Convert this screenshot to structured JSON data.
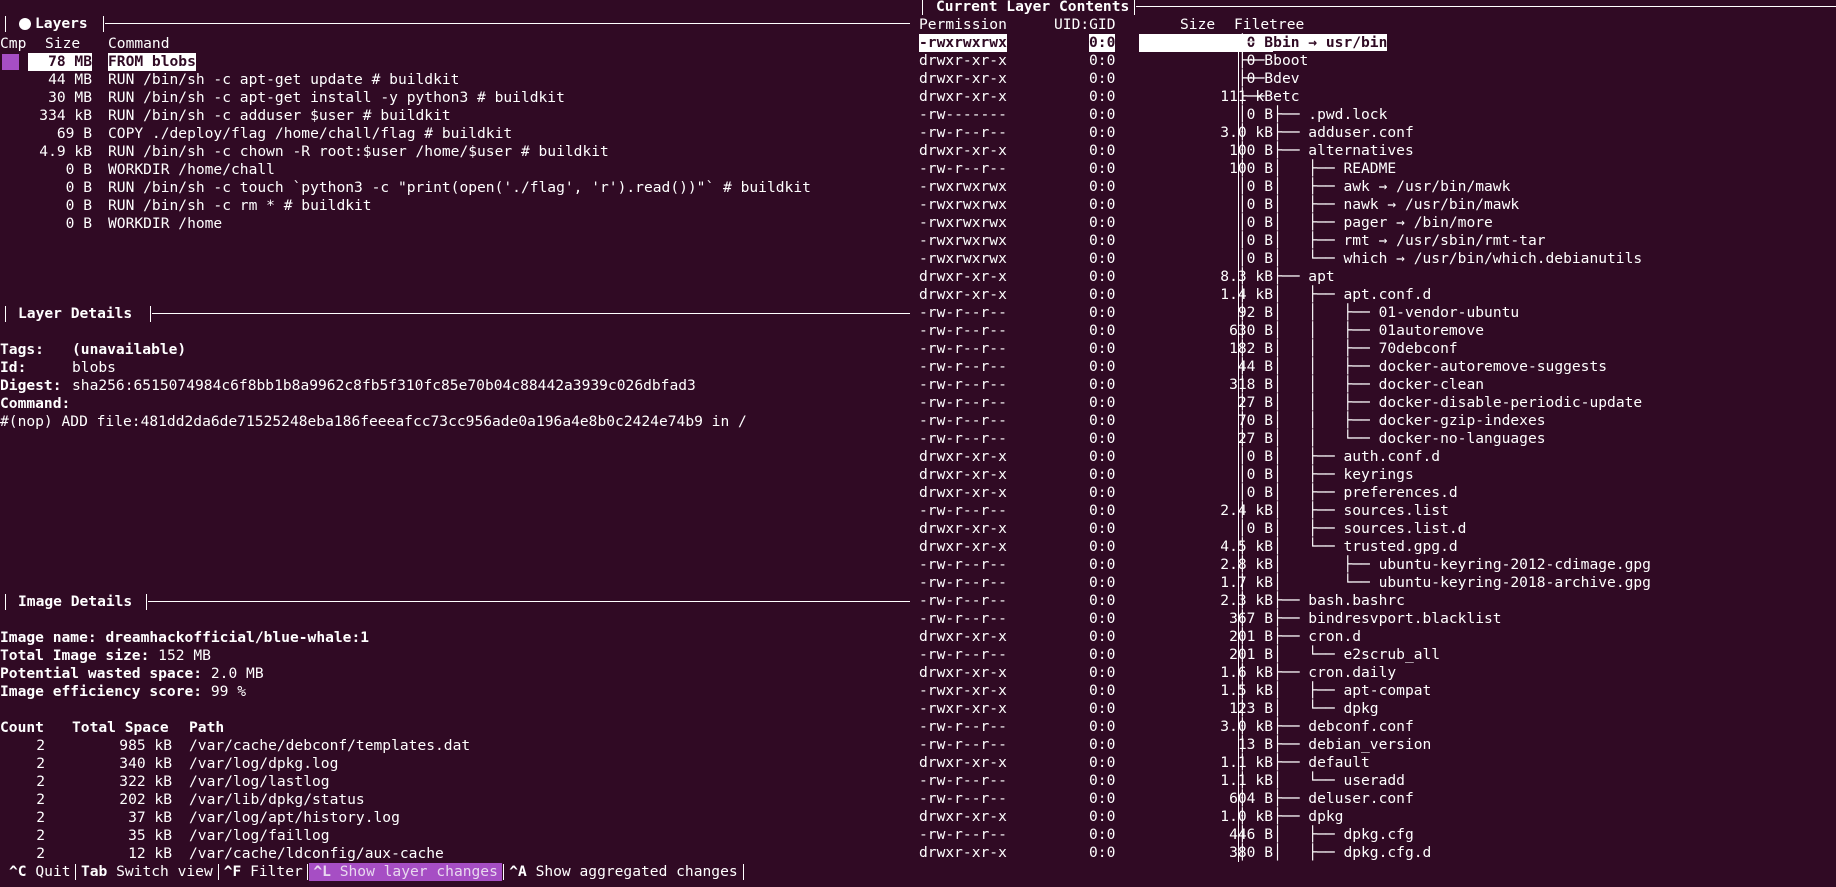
{
  "layers": {
    "title": "Layers",
    "col_cmp": "Cmp",
    "col_size": "Size",
    "col_command": "Command",
    "rows": [
      {
        "size": "78 MB",
        "command": "FROM blobs",
        "selected": true
      },
      {
        "size": "44 MB",
        "command": "RUN /bin/sh -c apt-get update # buildkit"
      },
      {
        "size": "30 MB",
        "command": "RUN /bin/sh -c apt-get install -y python3 # buildkit"
      },
      {
        "size": "334 kB",
        "command": "RUN /bin/sh -c adduser $user # buildkit"
      },
      {
        "size": "69 B",
        "command": "COPY ./deploy/flag /home/chall/flag # buildkit"
      },
      {
        "size": "4.9 kB",
        "command": "RUN /bin/sh -c chown -R root:$user /home/$user # buildkit"
      },
      {
        "size": "0 B",
        "command": "WORKDIR /home/chall"
      },
      {
        "size": "0 B",
        "command": "RUN /bin/sh -c touch `python3 -c \"print(open('./flag', 'r').read())\"` # buildkit"
      },
      {
        "size": "0 B",
        "command": "RUN /bin/sh -c rm * # buildkit"
      },
      {
        "size": "0 B",
        "command": "WORKDIR /home"
      }
    ],
    "cmp_color": "#a64ec4"
  },
  "layer_details": {
    "title": "Layer Details",
    "tags_label": "Tags:",
    "tags_value": "(unavailable)",
    "id_label": "Id:",
    "id_value": "blobs",
    "digest_label": "Digest:",
    "digest_value": "sha256:6515074984c6f8bb1b8a9962c8fb5f310fc85e70b04c88442a3939c026dbfad3",
    "command_label": "Command:",
    "command_value": "#(nop) ADD file:481dd2da6de71525248eba186feeeafcc73cc956ade0a196a4e8b0c2424e74b9 in /"
  },
  "image_details": {
    "title": "Image Details",
    "name_label": "Image name:",
    "name_value": "dreamhackofficial/blue-whale:1",
    "total_size_label": "Total Image size:",
    "total_size_value": "152 MB",
    "wasted_label": "Potential wasted space:",
    "wasted_value": "2.0 MB",
    "efficiency_label": "Image efficiency score:",
    "efficiency_value": "99 %",
    "col_count": "Count",
    "col_total_space": "Total Space",
    "col_path": "Path",
    "rows": [
      {
        "count": "2",
        "space": "985 kB",
        "path": "/var/cache/debconf/templates.dat"
      },
      {
        "count": "2",
        "space": "340 kB",
        "path": "/var/log/dpkg.log"
      },
      {
        "count": "2",
        "space": "322 kB",
        "path": "/var/log/lastlog"
      },
      {
        "count": "2",
        "space": "202 kB",
        "path": "/var/lib/dpkg/status"
      },
      {
        "count": "2",
        "space": "37 kB",
        "path": "/var/log/apt/history.log"
      },
      {
        "count": "2",
        "space": "35 kB",
        "path": "/var/log/faillog"
      },
      {
        "count": "2",
        "space": "12 kB",
        "path": "/var/cache/ldconfig/aux-cache"
      }
    ]
  },
  "contents": {
    "title": "Current Layer Contents",
    "col_permission": "Permission",
    "col_uidgid": "UID:GID",
    "col_size": "Size",
    "col_filetree": "Filetree",
    "rows": [
      {
        "perm": "-rwxrwxrwx",
        "uid": "0:0",
        "size": "0 B",
        "prefix": "├── ",
        "name": "bin → usr/bin",
        "selected": true
      },
      {
        "perm": "drwxr-xr-x",
        "uid": "0:0",
        "size": "0 B",
        "prefix": "├── ",
        "name": "boot"
      },
      {
        "perm": "drwxr-xr-x",
        "uid": "0:0",
        "size": "0 B",
        "prefix": "├── ",
        "name": "dev"
      },
      {
        "perm": "drwxr-xr-x",
        "uid": "0:0",
        "size": "111 kB",
        "prefix": "├── ",
        "name": "etc"
      },
      {
        "perm": "-rw-------",
        "uid": "0:0",
        "size": "0 B",
        "prefix": "│   ├── ",
        "name": ".pwd.lock"
      },
      {
        "perm": "-rw-r--r--",
        "uid": "0:0",
        "size": "3.0 kB",
        "prefix": "│   ├── ",
        "name": "adduser.conf"
      },
      {
        "perm": "drwxr-xr-x",
        "uid": "0:0",
        "size": "100 B",
        "prefix": "│   ├── ",
        "name": "alternatives"
      },
      {
        "perm": "-rw-r--r--",
        "uid": "0:0",
        "size": "100 B",
        "prefix": "│   │   ├── ",
        "name": "README"
      },
      {
        "perm": "-rwxrwxrwx",
        "uid": "0:0",
        "size": "0 B",
        "prefix": "│   │   ├── ",
        "name": "awk → /usr/bin/mawk"
      },
      {
        "perm": "-rwxrwxrwx",
        "uid": "0:0",
        "size": "0 B",
        "prefix": "│   │   ├── ",
        "name": "nawk → /usr/bin/mawk"
      },
      {
        "perm": "-rwxrwxrwx",
        "uid": "0:0",
        "size": "0 B",
        "prefix": "│   │   ├── ",
        "name": "pager → /bin/more"
      },
      {
        "perm": "-rwxrwxrwx",
        "uid": "0:0",
        "size": "0 B",
        "prefix": "│   │   ├── ",
        "name": "rmt → /usr/sbin/rmt-tar"
      },
      {
        "perm": "-rwxrwxrwx",
        "uid": "0:0",
        "size": "0 B",
        "prefix": "│   │   └── ",
        "name": "which → /usr/bin/which.debianutils"
      },
      {
        "perm": "drwxr-xr-x",
        "uid": "0:0",
        "size": "8.3 kB",
        "prefix": "│   ├── ",
        "name": "apt"
      },
      {
        "perm": "drwxr-xr-x",
        "uid": "0:0",
        "size": "1.4 kB",
        "prefix": "│   │   ├── ",
        "name": "apt.conf.d"
      },
      {
        "perm": "-rw-r--r--",
        "uid": "0:0",
        "size": "92 B",
        "prefix": "│   │   │   ├── ",
        "name": "01-vendor-ubuntu"
      },
      {
        "perm": "-rw-r--r--",
        "uid": "0:0",
        "size": "630 B",
        "prefix": "│   │   │   ├── ",
        "name": "01autoremove"
      },
      {
        "perm": "-rw-r--r--",
        "uid": "0:0",
        "size": "182 B",
        "prefix": "│   │   │   ├── ",
        "name": "70debconf"
      },
      {
        "perm": "-rw-r--r--",
        "uid": "0:0",
        "size": "44 B",
        "prefix": "│   │   │   ├── ",
        "name": "docker-autoremove-suggests"
      },
      {
        "perm": "-rw-r--r--",
        "uid": "0:0",
        "size": "318 B",
        "prefix": "│   │   │   ├── ",
        "name": "docker-clean"
      },
      {
        "perm": "-rw-r--r--",
        "uid": "0:0",
        "size": "27 B",
        "prefix": "│   │   │   ├── ",
        "name": "docker-disable-periodic-update"
      },
      {
        "perm": "-rw-r--r--",
        "uid": "0:0",
        "size": "70 B",
        "prefix": "│   │   │   ├── ",
        "name": "docker-gzip-indexes"
      },
      {
        "perm": "-rw-r--r--",
        "uid": "0:0",
        "size": "27 B",
        "prefix": "│   │   │   └── ",
        "name": "docker-no-languages"
      },
      {
        "perm": "drwxr-xr-x",
        "uid": "0:0",
        "size": "0 B",
        "prefix": "│   │   ├── ",
        "name": "auth.conf.d"
      },
      {
        "perm": "drwxr-xr-x",
        "uid": "0:0",
        "size": "0 B",
        "prefix": "│   │   ├── ",
        "name": "keyrings"
      },
      {
        "perm": "drwxr-xr-x",
        "uid": "0:0",
        "size": "0 B",
        "prefix": "│   │   ├── ",
        "name": "preferences.d"
      },
      {
        "perm": "-rw-r--r--",
        "uid": "0:0",
        "size": "2.4 kB",
        "prefix": "│   │   ├── ",
        "name": "sources.list"
      },
      {
        "perm": "drwxr-xr-x",
        "uid": "0:0",
        "size": "0 B",
        "prefix": "│   │   ├── ",
        "name": "sources.list.d"
      },
      {
        "perm": "drwxr-xr-x",
        "uid": "0:0",
        "size": "4.5 kB",
        "prefix": "│   │   └── ",
        "name": "trusted.gpg.d"
      },
      {
        "perm": "-rw-r--r--",
        "uid": "0:0",
        "size": "2.8 kB",
        "prefix": "│   │       ├── ",
        "name": "ubuntu-keyring-2012-cdimage.gpg"
      },
      {
        "perm": "-rw-r--r--",
        "uid": "0:0",
        "size": "1.7 kB",
        "prefix": "│   │       └── ",
        "name": "ubuntu-keyring-2018-archive.gpg"
      },
      {
        "perm": "-rw-r--r--",
        "uid": "0:0",
        "size": "2.3 kB",
        "prefix": "│   ├── ",
        "name": "bash.bashrc"
      },
      {
        "perm": "-rw-r--r--",
        "uid": "0:0",
        "size": "367 B",
        "prefix": "│   ├── ",
        "name": "bindresvport.blacklist"
      },
      {
        "perm": "drwxr-xr-x",
        "uid": "0:0",
        "size": "201 B",
        "prefix": "│   ├── ",
        "name": "cron.d"
      },
      {
        "perm": "-rw-r--r--",
        "uid": "0:0",
        "size": "201 B",
        "prefix": "│   │   └── ",
        "name": "e2scrub_all"
      },
      {
        "perm": "drwxr-xr-x",
        "uid": "0:0",
        "size": "1.6 kB",
        "prefix": "│   ├── ",
        "name": "cron.daily"
      },
      {
        "perm": "-rwxr-xr-x",
        "uid": "0:0",
        "size": "1.5 kB",
        "prefix": "│   │   ├── ",
        "name": "apt-compat"
      },
      {
        "perm": "-rwxr-xr-x",
        "uid": "0:0",
        "size": "123 B",
        "prefix": "│   │   └── ",
        "name": "dpkg"
      },
      {
        "perm": "-rw-r--r--",
        "uid": "0:0",
        "size": "3.0 kB",
        "prefix": "│   ├── ",
        "name": "debconf.conf"
      },
      {
        "perm": "-rw-r--r--",
        "uid": "0:0",
        "size": "13 B",
        "prefix": "│   ├── ",
        "name": "debian_version"
      },
      {
        "perm": "drwxr-xr-x",
        "uid": "0:0",
        "size": "1.1 kB",
        "prefix": "│   ├── ",
        "name": "default"
      },
      {
        "perm": "-rw-r--r--",
        "uid": "0:0",
        "size": "1.1 kB",
        "prefix": "│   │   └── ",
        "name": "useradd"
      },
      {
        "perm": "-rw-r--r--",
        "uid": "0:0",
        "size": "604 B",
        "prefix": "│   ├── ",
        "name": "deluser.conf"
      },
      {
        "perm": "drwxr-xr-x",
        "uid": "0:0",
        "size": "1.0 kB",
        "prefix": "│   ├── ",
        "name": "dpkg"
      },
      {
        "perm": "-rw-r--r--",
        "uid": "0:0",
        "size": "446 B",
        "prefix": "│   │   ├── ",
        "name": "dpkg.cfg"
      },
      {
        "perm": "drwxr-xr-x",
        "uid": "0:0",
        "size": "380 B",
        "prefix": "│   │   ├── ",
        "name": "dpkg.cfg.d"
      }
    ]
  },
  "statusbar": {
    "items": [
      {
        "key": "^C",
        "label": "Quit"
      },
      {
        "key": "Tab",
        "label": "Switch view"
      },
      {
        "key": "^F",
        "label": "Filter"
      },
      {
        "key": "^L",
        "label": "Show layer changes",
        "active": true
      },
      {
        "key": "^A",
        "label": "Show aggregated changes"
      }
    ]
  },
  "colors": {
    "background": "#300a24",
    "highlight": "#a64ec4",
    "foreground": "#ffffff"
  }
}
